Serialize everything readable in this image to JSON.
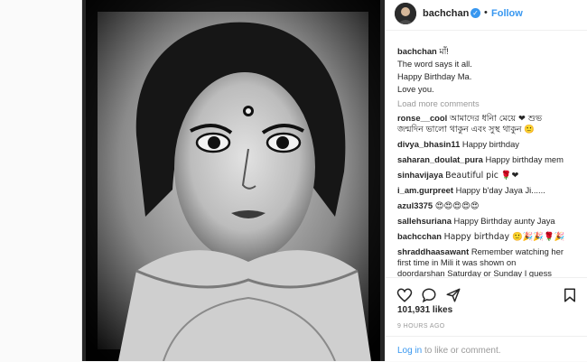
{
  "header": {
    "username": "bachchan",
    "verified_icon": "verified-badge-icon",
    "separator": "•",
    "follow_label": "Follow"
  },
  "caption": {
    "username": "bachchan",
    "first_line": "মাঁ!",
    "lines": [
      "The word says it all.",
      "Happy Birthday Ma.",
      "Love you."
    ]
  },
  "load_more": "Load more comments",
  "comments": [
    {
      "user": "ronse__cool",
      "text": "আমাদের ধনিা মেয়ে ❤ শুভ"
    },
    {
      "user": "",
      "text": "জন্মদিন ভালো থাকুন এবং সুস্থ থাকুন 🙂"
    },
    {
      "user": "divya_bhasin11",
      "text": "Happy birthday"
    },
    {
      "user": "saharan_doulat_pura",
      "text": "Happy birthday mem"
    },
    {
      "user": "sinhavijaya",
      "text": "Beautiful pic 🌹❤"
    },
    {
      "user": "i_am.gurpreet",
      "text": "Happy b'day Jaya Ji......"
    },
    {
      "user": "azul3375",
      "text": "😍😍😍😍😍"
    },
    {
      "user": "sallehsuriana",
      "text": "Happy Birthday aunty Jaya"
    },
    {
      "user": "bachcchan",
      "text": "Happy birthday 🙂🎉🎉🌹🎉"
    },
    {
      "user": "shraddhaasawant",
      "text": "Remember watching her"
    },
    {
      "user": "",
      "text": "first time in Mili it was shown on"
    },
    {
      "user": "",
      "text": "doordarshan Saturday or Sunday I guess"
    }
  ],
  "actions": {
    "like_icon": "heart-icon",
    "comment_icon": "comment-icon",
    "share_icon": "share-icon",
    "save_icon": "bookmark-icon"
  },
  "likes": "101,931 likes",
  "timestamp": "9 HOURS AGO",
  "footer": {
    "login_link": "Log in",
    "login_rest": " to like or comment."
  },
  "colors": {
    "link_blue": "#3897f0",
    "muted_gray": "#999999",
    "border": "#efefef"
  }
}
